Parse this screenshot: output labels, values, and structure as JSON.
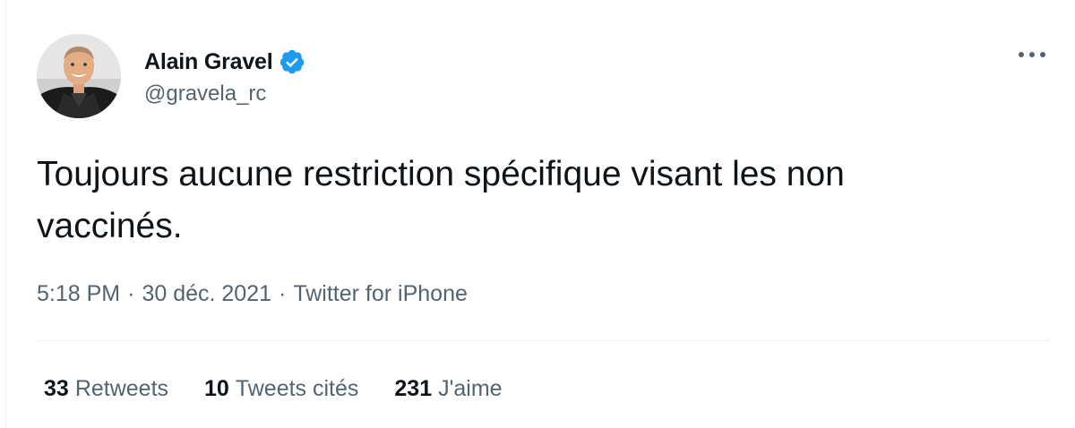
{
  "tweet": {
    "author": {
      "display_name": "Alain Gravel",
      "handle": "@gravela_rc",
      "verified": true,
      "verified_color": "#1d9bf0",
      "avatar_icon": "profile-photo"
    },
    "more_icon": "ellipsis-icon",
    "text": "Toujours aucune restriction spécifique visant les non\nvaccinés.",
    "time": "5:18 PM",
    "separator": "·",
    "date": "30 déc. 2021",
    "source": "Twitter for iPhone",
    "stats": {
      "retweets_count": "33",
      "retweets_label": "Retweets",
      "quotes_count": "10",
      "quotes_label": "Tweets cités",
      "likes_count": "231",
      "likes_label": "J'aime"
    }
  }
}
